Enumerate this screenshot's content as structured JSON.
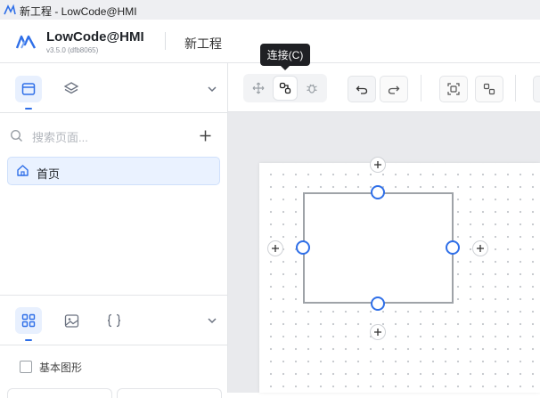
{
  "window": {
    "title": "新工程 - LowCode@HMI"
  },
  "header": {
    "brand": "LowCode@HMI",
    "version": "v3.5.0 (dfb8065)",
    "project_name": "新工程"
  },
  "left_panel": {
    "top_tabs": [
      {
        "icon": "page-icon",
        "active": true
      },
      {
        "icon": "layers-icon",
        "active": false
      }
    ],
    "search_placeholder": "搜索页面...",
    "pages": [
      {
        "label": "首页",
        "icon": "home-icon",
        "selected": true
      }
    ],
    "bottom_tabs": [
      {
        "icon": "grid-icon",
        "active": true
      },
      {
        "icon": "image-icon",
        "active": false
      },
      {
        "icon": "code-braces-icon",
        "active": false
      }
    ],
    "component_group": "基本图形"
  },
  "toolbar": {
    "tooltip": "连接(C)",
    "connect_label": "连接(C)"
  },
  "colors": {
    "accent": "#2f6fe8",
    "handle": "#2f6fe8",
    "shape_stroke": "#9fa3a8",
    "canvas_bg": "#e9eaed"
  }
}
